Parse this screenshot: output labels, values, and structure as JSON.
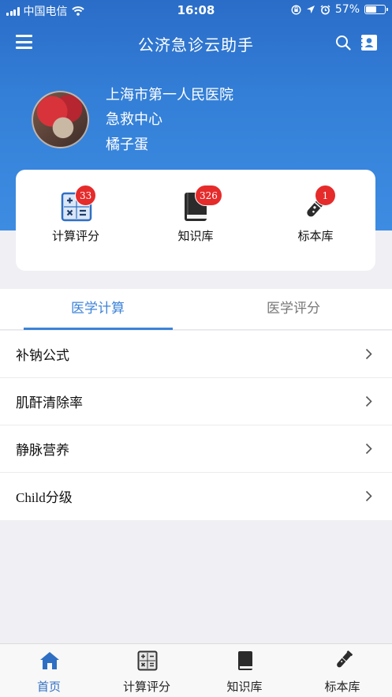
{
  "status_bar": {
    "carrier": "中国电信",
    "time": "16:08",
    "battery_percent": "57%",
    "battery_level": 0.57
  },
  "nav": {
    "title": "公济急诊云助手",
    "icons": [
      "menu-icon",
      "search-icon",
      "contact-card-icon"
    ]
  },
  "profile": {
    "hospital": "上海市第一人民医院",
    "department": "急救中心",
    "name": "橘子蛋"
  },
  "quick_cards": [
    {
      "label": "计算评分",
      "badge": "33",
      "icon": "calculator-icon"
    },
    {
      "label": "知识库",
      "badge": "326",
      "icon": "book-icon"
    },
    {
      "label": "标本库",
      "badge": "1",
      "icon": "test-tube-icon"
    }
  ],
  "tabs": [
    {
      "label": "医学计算",
      "active": true
    },
    {
      "label": "医学评分",
      "active": false
    }
  ],
  "list_items": [
    {
      "label": "补钠公式"
    },
    {
      "label": "肌酐清除率"
    },
    {
      "label": "静脉营养"
    },
    {
      "label": "Child分级"
    }
  ],
  "tab_bar": [
    {
      "label": "首页",
      "icon": "home-icon",
      "active": true
    },
    {
      "label": "计算评分",
      "icon": "calculator-icon",
      "active": false
    },
    {
      "label": "知识库",
      "icon": "book-icon",
      "active": false
    },
    {
      "label": "标本库",
      "icon": "test-tube-icon",
      "active": false
    }
  ],
  "colors": {
    "header_blue": "#2a6dc8",
    "accent_blue": "#3d83d8",
    "badge_red": "#e62b2b"
  }
}
